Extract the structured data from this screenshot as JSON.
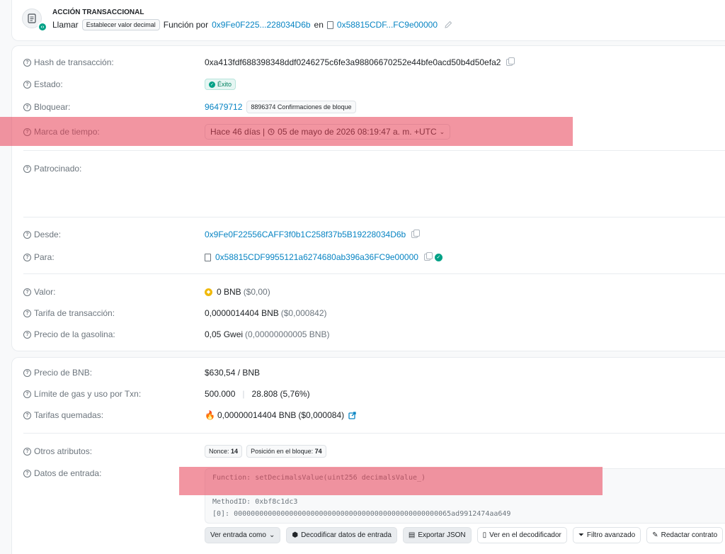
{
  "header": {
    "title": "ACCIÓN TRANSACCIONAL",
    "call_label": "Llamar",
    "method_tag": "Establecer valor decimal",
    "function_by": "Función por",
    "from_short": "0x9Fe0F225...228034D6b",
    "on_label": "en",
    "to_short": "0x58815CDF...FC9e00000"
  },
  "rows": {
    "hash": {
      "label": "Hash de transacción:",
      "value": "0xa413fdf688398348ddf0246275c6fe3a98806670252e44bfe0acd50b4d50efa2"
    },
    "status": {
      "label": "Estado:",
      "value": "Éxito"
    },
    "block": {
      "label": "Bloquear:",
      "value": "96479712",
      "confirmations": "8896374 Confirmaciones de bloque"
    },
    "timestamp": {
      "label": "Marca de tiempo:",
      "value": "Hace 46 días | ",
      "date": "05 de mayo de 2026 08:19:47 a. m. +UTC"
    },
    "sponsored": {
      "label": "Patrocinado:"
    },
    "from": {
      "label": "Desde:",
      "value": "0x9Fe0F22556CAFF3f0b1C258f37b5B19228034D6b"
    },
    "to": {
      "label": "Para:",
      "value": "0x58815CDF9955121a6274680ab396a36FC9e00000"
    },
    "value": {
      "label": "Valor:",
      "amount": "0 BNB",
      "usd": "($0,00)"
    },
    "fee": {
      "label": "Tarifa de transacción:",
      "amount": "0,0000014404 BNB",
      "usd": "($0,000842)"
    },
    "gas_price": {
      "label": "Precio de la gasolina:",
      "amount": "0,05 Gwei",
      "detail": "(0,00000000005 BNB)"
    },
    "bnb_price": {
      "label": "Precio de BNB:",
      "value": "$630,54 / BNB"
    },
    "gas_limit": {
      "label": "Límite de gas y uso por Txn:",
      "limit": "500.000",
      "separator": "|",
      "usage": "28.808 (5,76%)"
    },
    "burned": {
      "label": "Tarifas quemadas:",
      "amount": "0,00000014404 BNB",
      "usd": "($0,000084)"
    },
    "other": {
      "label": "Otros atributos:",
      "nonce_label": "Nonce:",
      "nonce": "14",
      "position_label": "Posición en el bloque:",
      "position": "74"
    },
    "input": {
      "label": "Datos de entrada:",
      "function_line": "Function: setDecimalsValue(uint256 decimalsValue_)",
      "method_line": "MethodID: 0xbf8c1dc3",
      "param_line": "[0]:  000000000000000000000000000000000000000000000000065ad9912474aa649"
    }
  },
  "buttons": {
    "view_input": "Ver entrada como",
    "decode": "Decodificar datos de entrada",
    "export_json": "Exportar JSON",
    "view_decoder": "Ver en el decodificador",
    "advanced_filter": "Filtro avanzado",
    "write_contract": "Redactar contrato"
  },
  "colors": {
    "link": "#0784c3",
    "success": "#00a186",
    "highlight": "#e83e54"
  }
}
